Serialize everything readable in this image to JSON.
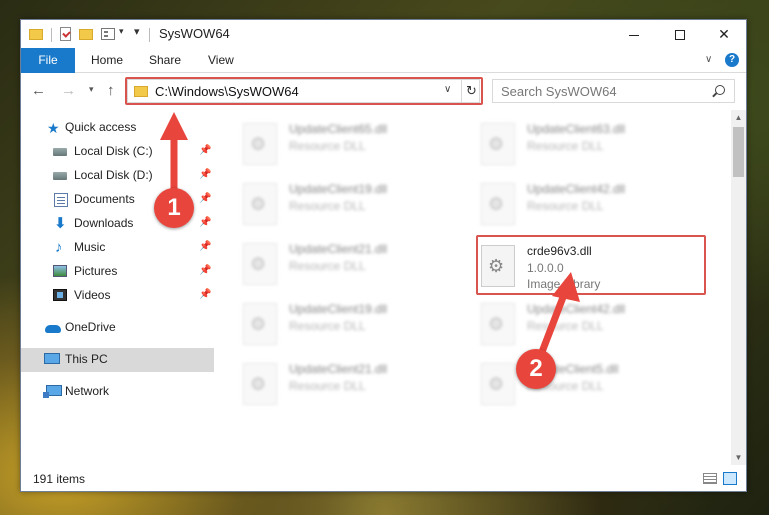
{
  "window": {
    "title": "SysWOW64",
    "controls": {
      "minimize": "minimize",
      "maximize": "maximize",
      "close": "✕"
    }
  },
  "ribbon": {
    "tabs": [
      "File",
      "Home",
      "Share",
      "View"
    ]
  },
  "address": {
    "path": "C:\\Windows\\SysWOW64",
    "search_placeholder": "Search SysWOW64"
  },
  "sidebar": {
    "quick_access": "Quick access",
    "items": [
      {
        "label": "Local Disk (C:)",
        "icon": "drive-icon",
        "pinned": true
      },
      {
        "label": "Local Disk (D:)",
        "icon": "drive-icon",
        "pinned": true
      },
      {
        "label": "Documents",
        "icon": "documents-icon",
        "pinned": true
      },
      {
        "label": "Downloads",
        "icon": "download-icon",
        "pinned": true
      },
      {
        "label": "Music",
        "icon": "music-icon",
        "pinned": true
      },
      {
        "label": "Pictures",
        "icon": "pictures-icon",
        "pinned": true
      },
      {
        "label": "Videos",
        "icon": "videos-icon",
        "pinned": true
      }
    ],
    "onedrive": "OneDrive",
    "this_pc": "This PC",
    "network": "Network"
  },
  "files": {
    "left": [
      {
        "name": "UpdateClient65.dll",
        "type": "Resource DLL"
      },
      {
        "name": "UpdateClient19.dll",
        "type": "Resource DLL"
      },
      {
        "name": "UpdateClient21.dll",
        "type": "Resource DLL"
      },
      {
        "name": "UpdateClient19.dll",
        "type": "Resource DLL"
      },
      {
        "name": "UpdateClient21.dll",
        "type": "Resource DLL"
      }
    ],
    "right": [
      {
        "name": "UpdateClient63.dll",
        "type": "Resource DLL"
      },
      {
        "name": "UpdateClient42.dll",
        "type": "Resource DLL"
      },
      {
        "name": "UpdateClient42.dll",
        "type": "Resource DLL"
      },
      {
        "name": "UpdateClient5.dll",
        "type": "Resource DLL"
      }
    ],
    "target": {
      "name": "crde96v3.dll",
      "version": "1.0.0.0",
      "type": "Image Library"
    }
  },
  "status": {
    "count": "191 items"
  },
  "callouts": {
    "one": "1",
    "two": "2"
  },
  "colors": {
    "accent": "#1979ca",
    "highlight": "#d9534f",
    "callout": "#e8453c"
  }
}
